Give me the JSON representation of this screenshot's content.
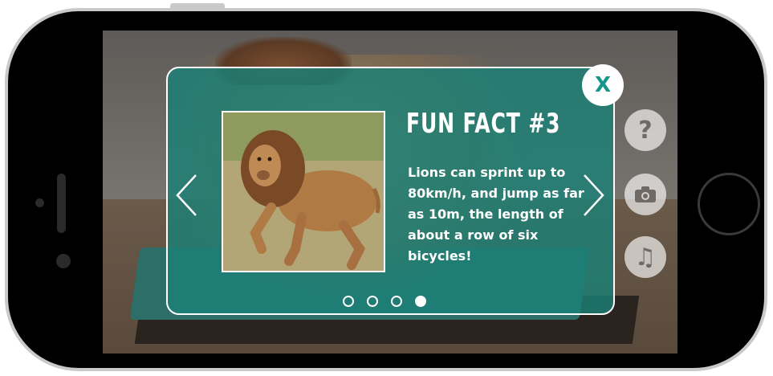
{
  "fun_fact": {
    "title": "FUN FACT #3",
    "body": "Lions can sprint up to 80km/h, and jump as far as 10m, the length of about a row of six bicycles!",
    "close_label": "X"
  },
  "pagination": {
    "total": 4,
    "active_index": 3
  },
  "side_icons": [
    {
      "name": "help-icon",
      "glyph": "?"
    },
    {
      "name": "camera-icon",
      "glyph": ""
    },
    {
      "name": "music-icon",
      "glyph": "♫"
    }
  ],
  "colors": {
    "card_teal": "#1b8076",
    "accent_teal": "#18958a",
    "white": "#ffffff"
  }
}
